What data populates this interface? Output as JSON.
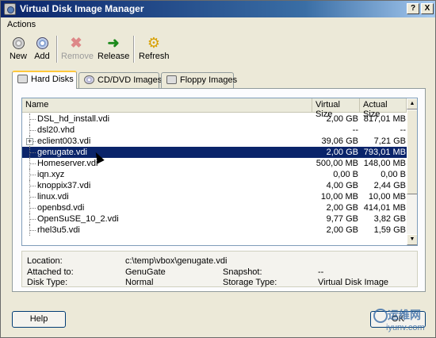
{
  "window": {
    "title": "Virtual Disk Image Manager",
    "help_btn": "?",
    "close_btn": "X"
  },
  "menu": {
    "actions": "Actions"
  },
  "toolbar": {
    "new": "New",
    "add": "Add",
    "remove": "Remove",
    "release": "Release",
    "refresh": "Refresh"
  },
  "tabs": [
    {
      "label": "Hard Disks",
      "active": true
    },
    {
      "label": "CD/DVD Images",
      "active": false
    },
    {
      "label": "Floppy Images",
      "active": false
    }
  ],
  "columns": {
    "name": "Name",
    "virtual": "Virtual Size",
    "actual": "Actual Size"
  },
  "disks": [
    {
      "name": "DSL_hd_install.vdi",
      "virtual": "2,00 GB",
      "actual": "817,01 MB",
      "expander": false
    },
    {
      "name": "dsl20.vhd",
      "virtual": "--",
      "actual": "--",
      "expander": false
    },
    {
      "name": "eclient003.vdi",
      "virtual": "39,06 GB",
      "actual": "7,21 GB",
      "expander": true
    },
    {
      "name": "genugate.vdi",
      "virtual": "2,00 GB",
      "actual": "793,01 MB",
      "selected": true
    },
    {
      "name": "Homeserver.vdi",
      "virtual": "500,00 MB",
      "actual": "148,00 MB"
    },
    {
      "name": "iqn.xyz",
      "virtual": "0,00 B",
      "actual": "0,00 B"
    },
    {
      "name": "knoppix37.vdi",
      "virtual": "4,00 GB",
      "actual": "2,44 GB"
    },
    {
      "name": "linux.vdi",
      "virtual": "10,00 MB",
      "actual": "10,00 MB"
    },
    {
      "name": "openbsd.vdi",
      "virtual": "2,00 GB",
      "actual": "414,01 MB"
    },
    {
      "name": "OpenSuSE_10_2.vdi",
      "virtual": "9,77 GB",
      "actual": "3,82 GB"
    },
    {
      "name": "rhel3u5.vdi",
      "virtual": "2,00 GB",
      "actual": "1,59 GB"
    }
  ],
  "details": {
    "location_label": "Location:",
    "location": "c:\\temp\\vbox\\genugate.vdi",
    "attached_label": "Attached to:",
    "attached": "GenuGate",
    "snapshot_label": "Snapshot:",
    "snapshot": "--",
    "disktype_label": "Disk Type:",
    "disktype": "Normal",
    "storage_label": "Storage Type:",
    "storage": "Virtual Disk Image"
  },
  "buttons": {
    "help": "Help",
    "ok": "OK"
  },
  "watermark": {
    "text": "运维网",
    "sub": "iyunv.com"
  },
  "colors": {
    "selection": "#0a246a",
    "titlebar": "#0a246a",
    "tab_highlight": "#ffc83c"
  }
}
